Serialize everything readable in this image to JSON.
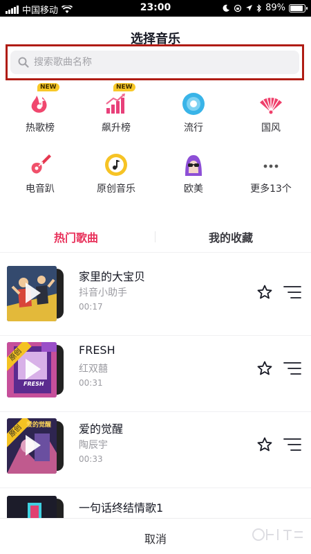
{
  "status_bar": {
    "carrier": "中国移动",
    "time": "23:00",
    "battery": "89%",
    "battery_level": 0.89
  },
  "header": {
    "title": "选择音乐"
  },
  "search": {
    "placeholder": "搜索歌曲名称"
  },
  "categories": [
    {
      "label": "热歌榜",
      "icon": "music-note-flame-icon",
      "badge": "NEW"
    },
    {
      "label": "飙升榜",
      "icon": "rising-chart-icon",
      "badge": "NEW"
    },
    {
      "label": "流行",
      "icon": "disc-icon"
    },
    {
      "label": "国风",
      "icon": "folding-fan-icon"
    },
    {
      "label": "电音趴",
      "icon": "electric-guitar-icon"
    },
    {
      "label": "原创音乐",
      "icon": "note-circle-icon"
    },
    {
      "label": "欧美",
      "icon": "sunglasses-face-icon"
    },
    {
      "label": "更多13个",
      "icon": "more-dots-icon"
    }
  ],
  "tabs": [
    {
      "label": "热门歌曲",
      "active": true
    },
    {
      "label": "我的收藏",
      "active": false
    }
  ],
  "songs": [
    {
      "title": "家里的大宝贝",
      "artist": "抖音小助手",
      "duration": "00:17"
    },
    {
      "title": "FRESH",
      "artist": "红双囍",
      "duration": "00:31",
      "tag": "原创",
      "cover_text": "FRESH"
    },
    {
      "title": "爱的觉醒",
      "artist": "陶辰宇",
      "duration": "00:33",
      "tag": "原创",
      "cover_text": "爱的觉醒"
    },
    {
      "title": "一句话终结情歌1"
    }
  ],
  "footer": {
    "cancel": "取消"
  },
  "colors": {
    "accent": "#e8305a",
    "highlight_border": "#b01c14",
    "badge": "#f8c828"
  }
}
